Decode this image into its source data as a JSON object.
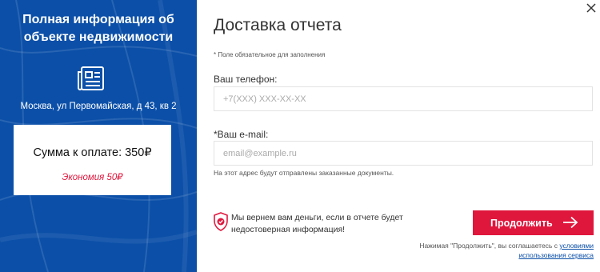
{
  "summary": {
    "title": "Полная информация об объекте недвижимости",
    "address": "Москва, ул Первомайская, д 43, кв 2",
    "price_label": "Сумма к оплате: 350₽",
    "savings_label": "Экономия 50₽"
  },
  "form": {
    "title": "Доставка отчета",
    "required_note": "* Поле обязательное для заполнения",
    "phone_label": "Ваш телефон:",
    "phone_placeholder": "+7(XXX) XXX-XX-XX",
    "email_label": "*Ваш e-mail:",
    "email_placeholder": "email@example.ru",
    "email_hint": "На этот адрес будут отправлены заказанные документы.",
    "guarantee_text": "Мы вернем вам деньги, если в отчете будет недостоверная информация!",
    "continue_label": "Продолжить",
    "agree_prefix": "Нажимая \"Продолжить\", вы соглашаетесь с",
    "agree_link": "условиями использования сервиса"
  },
  "colors": {
    "panel_blue": "#0b4fa8",
    "accent_red": "#e0173d"
  },
  "icons": {
    "document": "newspaper-document-icon",
    "shield": "shield-check-icon",
    "arrow": "arrow-right-icon",
    "close": "close-icon"
  }
}
